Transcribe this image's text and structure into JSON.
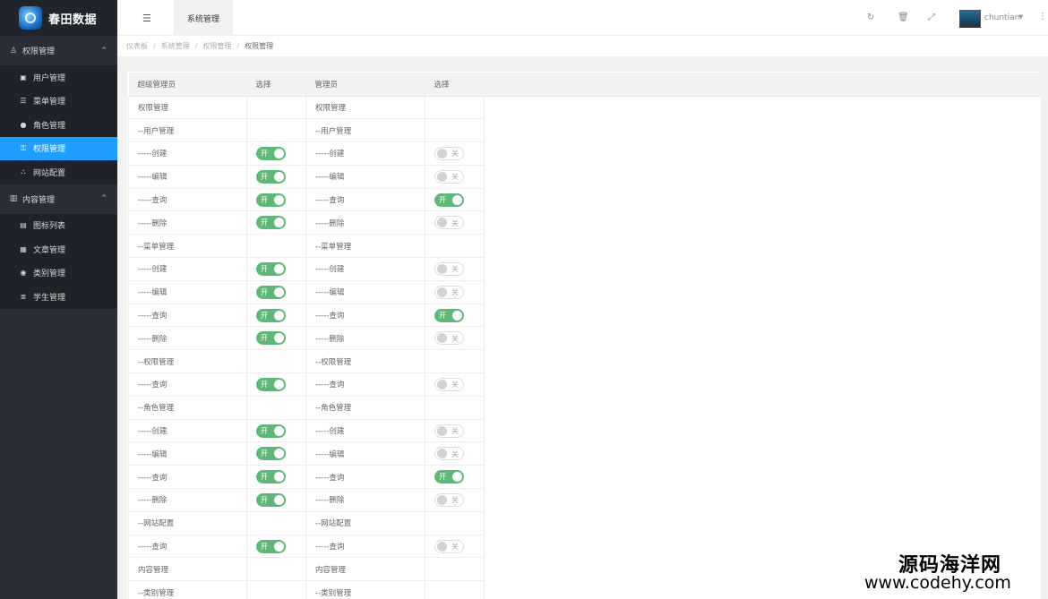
{
  "app": {
    "title": "春田数据"
  },
  "sidebar": {
    "groups": [
      {
        "label": "权限管理",
        "icon": "user-icon",
        "items": [
          {
            "label": "用户管理",
            "icon": "id-card-icon",
            "active": false
          },
          {
            "label": "菜单管理",
            "icon": "list-icon",
            "active": false
          },
          {
            "label": "角色管理",
            "icon": "circle-icon",
            "active": false
          },
          {
            "label": "权限管理",
            "icon": "key-icon",
            "active": true
          },
          {
            "label": "网站配置",
            "icon": "sitemap-icon",
            "active": false
          }
        ]
      },
      {
        "label": "内容管理",
        "icon": "bar-chart-icon",
        "items": [
          {
            "label": "图标列表",
            "icon": "doc-icon",
            "active": false
          },
          {
            "label": "文章管理",
            "icon": "calendar-icon",
            "active": false
          },
          {
            "label": "类别管理",
            "icon": "tag-icon",
            "active": false
          },
          {
            "label": "学生管理",
            "icon": "database-icon",
            "active": false
          }
        ]
      }
    ]
  },
  "header": {
    "tab_label": "系统管理",
    "username": "chuntian"
  },
  "breadcrumb": [
    "仪表板",
    "系统管理",
    "权限管理",
    "权限管理"
  ],
  "table": {
    "headers": [
      "超级管理员",
      "选择",
      "管理员",
      "选择"
    ],
    "on_label": "开",
    "off_label": "关",
    "rows": [
      {
        "left": "权限管理",
        "left_sw": null,
        "right": "权限管理",
        "right_sw": null
      },
      {
        "left": "--用户管理",
        "left_sw": null,
        "right": "--用户管理",
        "right_sw": null
      },
      {
        "left": "-----创建",
        "left_sw": true,
        "right": "-----创建",
        "right_sw": false
      },
      {
        "left": "-----编辑",
        "left_sw": true,
        "right": "-----编辑",
        "right_sw": false
      },
      {
        "left": "-----查询",
        "left_sw": true,
        "right": "-----查询",
        "right_sw": true
      },
      {
        "left": "-----删除",
        "left_sw": true,
        "right": "-----删除",
        "right_sw": false
      },
      {
        "left": "--菜单管理",
        "left_sw": null,
        "right": "--菜单管理",
        "right_sw": null
      },
      {
        "left": "-----创建",
        "left_sw": true,
        "right": "-----创建",
        "right_sw": false
      },
      {
        "left": "-----编辑",
        "left_sw": true,
        "right": "-----编辑",
        "right_sw": false
      },
      {
        "left": "-----查询",
        "left_sw": true,
        "right": "-----查询",
        "right_sw": true
      },
      {
        "left": "-----删除",
        "left_sw": true,
        "right": "-----删除",
        "right_sw": false
      },
      {
        "left": "--权限管理",
        "left_sw": null,
        "right": "--权限管理",
        "right_sw": null
      },
      {
        "left": "-----查询",
        "left_sw": true,
        "right": "-----查询",
        "right_sw": false
      },
      {
        "left": "--角色管理",
        "left_sw": null,
        "right": "--角色管理",
        "right_sw": null
      },
      {
        "left": "-----创建",
        "left_sw": true,
        "right": "-----创建",
        "right_sw": false
      },
      {
        "left": "-----编辑",
        "left_sw": true,
        "right": "-----编辑",
        "right_sw": false
      },
      {
        "left": "-----查询",
        "left_sw": true,
        "right": "-----查询",
        "right_sw": true
      },
      {
        "left": "-----删除",
        "left_sw": true,
        "right": "-----删除",
        "right_sw": false
      },
      {
        "left": "--网站配置",
        "left_sw": null,
        "right": "--网站配置",
        "right_sw": null
      },
      {
        "left": "-----查询",
        "left_sw": true,
        "right": "-----查询",
        "right_sw": false
      },
      {
        "left": "内容管理",
        "left_sw": null,
        "right": "内容管理",
        "right_sw": null
      },
      {
        "left": "--类别管理",
        "left_sw": null,
        "right": "--类别管理",
        "right_sw": null
      }
    ]
  },
  "watermark": {
    "line1": "源码海洋网",
    "line2": "www.codehy.com"
  },
  "colors": {
    "sidebar_bg": "#2a2e36",
    "active_item": "#1e9fff",
    "switch_on": "#5fb878"
  }
}
